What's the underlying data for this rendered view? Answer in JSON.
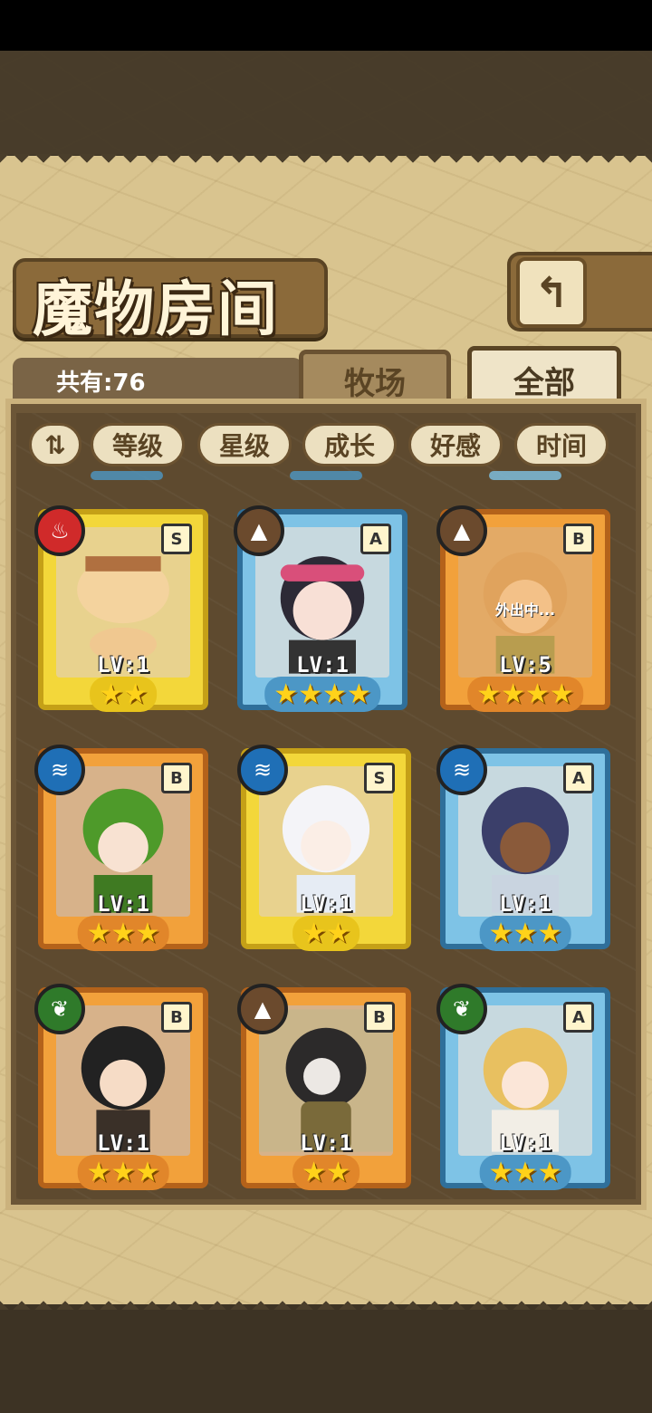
{
  "title": "魔物房间",
  "count_label": "共有:76",
  "tabs": [
    {
      "label": "牧场"
    },
    {
      "label": "全部"
    }
  ],
  "sort_buttons": [
    {
      "label": "等级"
    },
    {
      "label": "星级"
    },
    {
      "label": "成长"
    },
    {
      "label": "好感"
    },
    {
      "label": "时间"
    }
  ],
  "order_icon": "sort-order-icon",
  "back_icon": "return-arrow-icon",
  "cards": [
    {
      "rank": "S",
      "element": "fire-icon",
      "level": "LV:1",
      "stars": 2,
      "star_text": "★★",
      "away": ""
    },
    {
      "rank": "A",
      "element": "earth-icon",
      "level": "LV:1",
      "stars": 4,
      "star_text": "★★★★",
      "away": ""
    },
    {
      "rank": "B",
      "element": "earth-icon",
      "level": "LV:5",
      "stars": 4,
      "star_text": "★★★★",
      "away": "外出中..."
    },
    {
      "rank": "B",
      "element": "water-icon",
      "level": "LV:1",
      "stars": 3,
      "star_text": "★★★",
      "away": ""
    },
    {
      "rank": "S",
      "element": "water-icon",
      "level": "LV:1",
      "stars": 2,
      "star_text": "★★",
      "away": ""
    },
    {
      "rank": "A",
      "element": "water-icon",
      "level": "LV:1",
      "stars": 3,
      "star_text": "★★★",
      "away": ""
    },
    {
      "rank": "B",
      "element": "wood-icon",
      "level": "LV:1",
      "stars": 3,
      "star_text": "★★★",
      "away": ""
    },
    {
      "rank": "B",
      "element": "earth-icon",
      "level": "LV:1",
      "stars": 2,
      "star_text": "★★",
      "away": ""
    },
    {
      "rank": "A",
      "element": "wood-icon",
      "level": "LV:1",
      "stars": 3,
      "star_text": "★★★",
      "away": ""
    }
  ],
  "colors": {
    "rank_S": "#f3d73a",
    "rank_A": "#7ec3e6",
    "rank_B": "#f2a13b",
    "parchment": "#d9c48f"
  }
}
